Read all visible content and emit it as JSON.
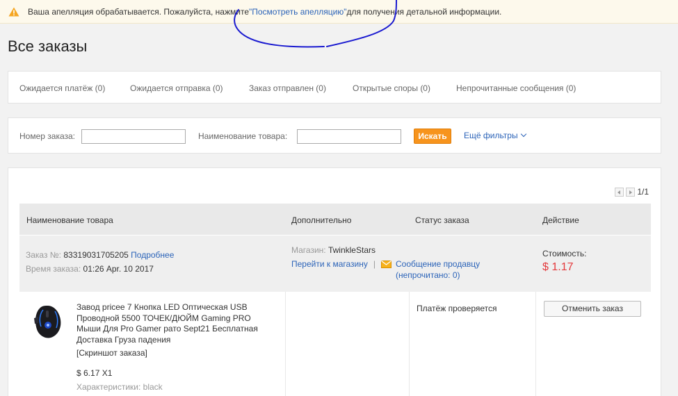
{
  "notice": {
    "text_before": "Ваша апелляция обрабатывается. Пожалуйста, нажмите ",
    "link": "\"Посмотреть апелляцию\"",
    "text_after": " для получения детальной информации."
  },
  "page_title": "Все заказы",
  "tabs": [
    "Ожидается платёж (0)",
    "Ожидается отправка (0)",
    "Заказ отправлен (0)",
    "Открытые споры (0)",
    "Непрочитанные сообщения (0)"
  ],
  "filters": {
    "order_number_label": "Номер заказа:",
    "order_number_value": "",
    "product_name_label": "Наименование товара:",
    "product_name_value": "",
    "search_button": "Искать",
    "more_filters": "Ещё фильтры"
  },
  "pager": {
    "page_text": "1/1"
  },
  "table_headers": [
    "Наименование товара",
    "Дополнительно",
    "Статус заказа",
    "Действие"
  ],
  "order": {
    "order_no_label": "Заказ №:",
    "order_no": "83319031705205",
    "details_link": "Подробнее",
    "order_time_label": "Время заказа:",
    "order_time": "01:26 Apr. 10 2017",
    "store_label": "Магазин:",
    "store_name": "TwinkleStars",
    "go_to_store": "Перейти к магазину",
    "separator": "|",
    "message_seller": "Сообщение продавцу",
    "unread_prefix": "(непрочитано: ",
    "unread_count": "0",
    "unread_suffix": ")",
    "cost_label": "Стоимость:",
    "cost": "$ 1.17",
    "product_title": "Завод pricee 7 Кнопка LED Оптическая USB Проводной 5500 ТОЧЕК/ДЮЙМ Gaming PRO Мыши Для Pro Gamer рато Sept21 Бесплатная Доставка Груза падения",
    "snapshot": "[Скриншот заказа]",
    "unit_price": "$ 6.17 X1",
    "spec_label": "Характеристики:",
    "spec_value": "black",
    "status": "Платёж проверяется",
    "cancel_button": "Отменить заказ"
  },
  "colors": {
    "accent_orange": "#f7941d",
    "link_blue": "#2b63b8",
    "price_red": "#e4393c",
    "notice_bg": "#fdf9ec",
    "scribble_blue": "#1a1ad0"
  },
  "icons": [
    "warning-icon",
    "envelope-icon",
    "chevron-down-icon",
    "prev-page-icon",
    "next-page-icon"
  ]
}
